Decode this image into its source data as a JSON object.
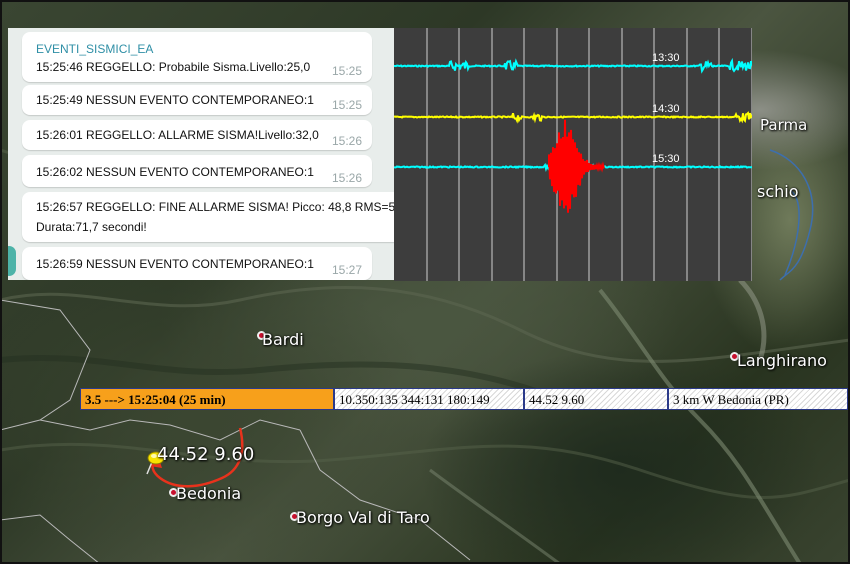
{
  "chat": {
    "channel": "EVENTI_SISMICI_EA",
    "messages": [
      {
        "text": "15:25:46 REGGELLO: Probabile Sisma.Livello:25,0",
        "time": "15:25"
      },
      {
        "text": "15:25:49 NESSUN EVENTO CONTEMPORANEO:1",
        "time": "15:25"
      },
      {
        "text": "15:26:01 REGGELLO: ALLARME SISMA!Livello:32,0",
        "time": "15:26"
      },
      {
        "text": "15:26:02 NESSUN EVENTO CONTEMPORANEO:1",
        "time": "15:26"
      },
      {
        "text": "15:26:57 REGGELLO: FINE ALLARME SISMA! Picco: 48,8 RMS=5",
        "text2": "Durata:71,7 secondi!",
        "time": ""
      },
      {
        "text": "15:26:59 NESSUN EVENTO CONTEMPORANEO:1",
        "time": "15:27"
      }
    ]
  },
  "seismograph": {
    "trace_labels": [
      "13:30",
      "14:30",
      "15:30"
    ],
    "trace_colors": [
      "#00ffff",
      "#ffff00",
      "#00ffff"
    ],
    "event_color": "#ff0000"
  },
  "infobar": {
    "magnitude_time": "3.5 ---> 15:25:04 (25 min)",
    "params": "10.350:135 344:131 180:149",
    "coords": "44.52 9.60",
    "location": "3 km W Bedonia (PR)"
  },
  "map": {
    "places": {
      "parma": "Parma",
      "schio": "schio",
      "bardi": "Bardi",
      "langhirano": "Langhirano",
      "bedonia": "Bedonia",
      "borgo": "Borgo Val di Taro"
    },
    "pin_label": "44.52 9.60",
    "pin_color": "#f7e400",
    "arrow_color": "#e8321c"
  }
}
